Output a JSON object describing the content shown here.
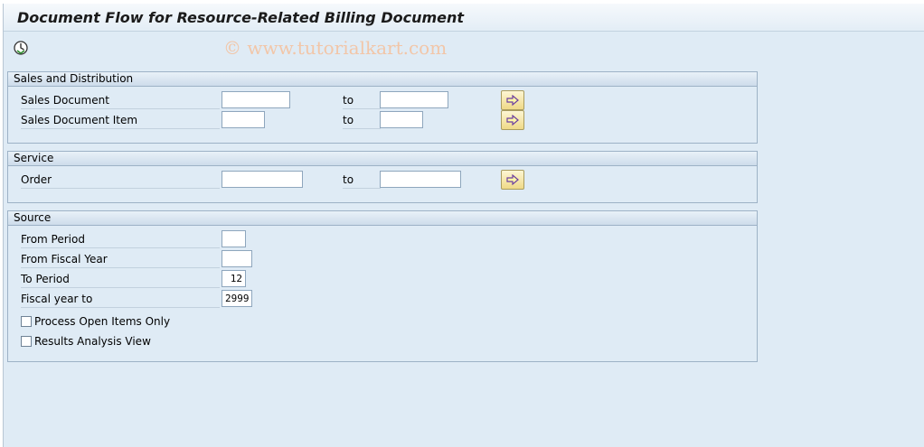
{
  "window": {
    "title": "Document Flow for Resource-Related Billing Document",
    "watermark": "© www.tutorialkart.com"
  },
  "toolbar": {
    "execute_icon": "execute-icon"
  },
  "sales_distribution": {
    "header": "Sales and Distribution",
    "sales_document_label": "Sales Document",
    "sales_document_from": "",
    "sales_document_to_label": "to",
    "sales_document_to": "",
    "sales_document_item_label": "Sales Document Item",
    "sales_document_item_from": "",
    "sales_document_item_to_label": "to",
    "sales_document_item_to": ""
  },
  "service": {
    "header": "Service",
    "order_label": "Order",
    "order_from": "",
    "order_to_label": "to",
    "order_to": ""
  },
  "source": {
    "header": "Source",
    "from_period_label": "From Period",
    "from_period": "",
    "from_fiscal_year_label": "From Fiscal Year",
    "from_fiscal_year": "",
    "to_period_label": "To Period",
    "to_period": "12",
    "fiscal_year_to_label": "Fiscal year to",
    "fiscal_year_to": "2999",
    "process_open_items_label": "Process Open Items Only",
    "process_open_items": false,
    "results_analysis_label": "Results Analysis View",
    "results_analysis": false
  },
  "colors": {
    "background": "#dfebf5",
    "multi_button": "#f0dc8c",
    "arrow": "#6b3fa0"
  }
}
